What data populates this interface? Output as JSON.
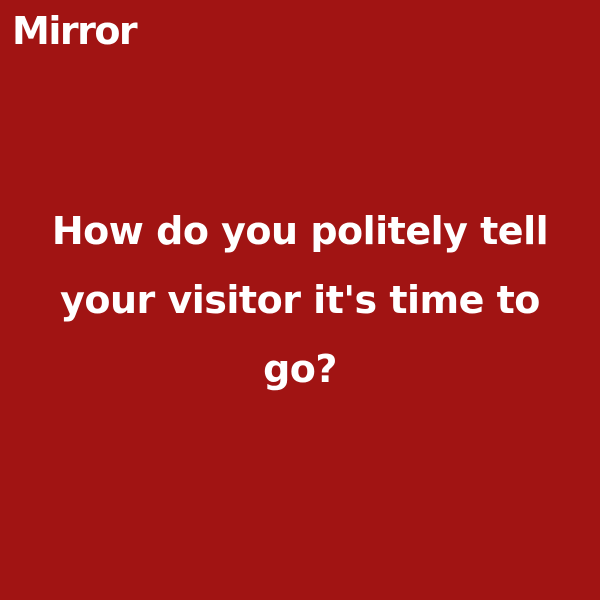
{
  "brand": {
    "logo_text": "Mirror"
  },
  "card": {
    "question": "How do you politely tell your visitor it's time to go?",
    "background_color": "#a11413",
    "text_color": "#ffffff"
  }
}
